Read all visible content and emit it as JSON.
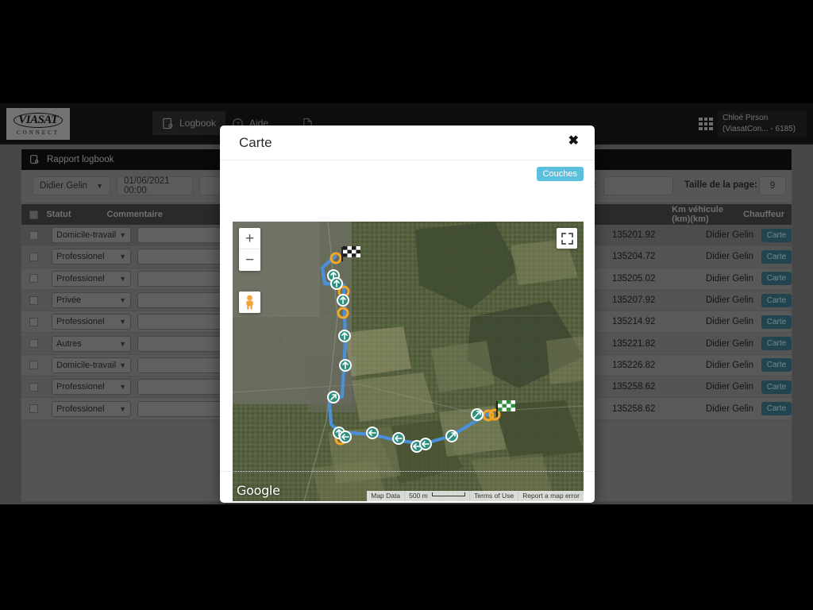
{
  "navbar": {
    "logo_main": "VIASAT",
    "logo_sub": "CONNECT",
    "items": [
      {
        "label": "Logbook",
        "icon": "logbook-icon",
        "active": true
      },
      {
        "label": "Aide",
        "icon": "help-icon",
        "active": false
      },
      {
        "label": "",
        "icon": "document-icon",
        "active": false
      }
    ],
    "apps_icon": "apps-grid-icon",
    "user_name": "Chloé Pirson",
    "user_account": "(ViasatCon...  - 6185)"
  },
  "panel": {
    "title": "Rapport logbook",
    "title_icon": "report-logbook-icon",
    "filters": {
      "driver_value": "Didier Gelin",
      "date_from_value": "01/06/2021 00:00",
      "filtre_label": "Filtre:",
      "filtre_value": "",
      "page_size_label": "Taille de la page:",
      "page_size_value": "9"
    },
    "table": {
      "headers": {
        "statut": "Statut",
        "commentaire": "Commentaire",
        "km_vehicule": "Km véhicule (km)(km)",
        "chauffeur": "Chauffeur"
      },
      "rows": [
        {
          "statut": "Domicile-travail",
          "commentaire": "",
          "km": "135201.92",
          "chauffeur": "Didier Gelin",
          "action": "Carte"
        },
        {
          "statut": "Professionel",
          "commentaire": "",
          "km": "135204.72",
          "chauffeur": "Didier Gelin",
          "action": "Carte"
        },
        {
          "statut": "Professionel",
          "commentaire": "",
          "km": "135205.02",
          "chauffeur": "Didier Gelin",
          "action": "Carte"
        },
        {
          "statut": "Privée",
          "commentaire": "",
          "km": "135207.92",
          "chauffeur": "Didier Gelin",
          "action": "Carte"
        },
        {
          "statut": "Professionel",
          "commentaire": "",
          "km": "135214.92",
          "chauffeur": "Didier Gelin",
          "action": "Carte"
        },
        {
          "statut": "Autres",
          "commentaire": "",
          "km": "135221.82",
          "chauffeur": "Didier Gelin",
          "action": "Carte"
        },
        {
          "statut": "Domicile-travail",
          "commentaire": "",
          "km": "135226.82",
          "chauffeur": "Didier Gelin",
          "action": "Carte"
        },
        {
          "statut": "Professionel",
          "commentaire": "",
          "km": "135258.62",
          "chauffeur": "Didier Gelin",
          "action": "Carte"
        },
        {
          "statut": "Professionel",
          "commentaire": "",
          "km": "135258.62",
          "chauffeur": "Didier Gelin",
          "action": "Carte"
        }
      ]
    }
  },
  "modal": {
    "title": "Carte",
    "close_label": "✖",
    "layers_button": "Couches",
    "map": {
      "zoom_in": "+",
      "zoom_out": "−",
      "pegman_icon": "street-view-pegman-icon",
      "fullscreen_icon": "fullscreen-icon",
      "watermark": "Google",
      "attribution": [
        "Map Data",
        "500 m",
        "Terms of Use",
        "Report a map error"
      ],
      "scale_text": "500 m",
      "route_color": "#4a90d9",
      "start_flag": "checkered-flag-black",
      "end_flag": "checkered-flag-green"
    }
  },
  "colors": {
    "accent_blue": "#5bc0de",
    "action_teal": "#3c7d91",
    "route": "#4a90d9",
    "navbar": "#1b1b1b",
    "marker_orange": "#f5a623",
    "marker_green": "#2f9e6e"
  }
}
